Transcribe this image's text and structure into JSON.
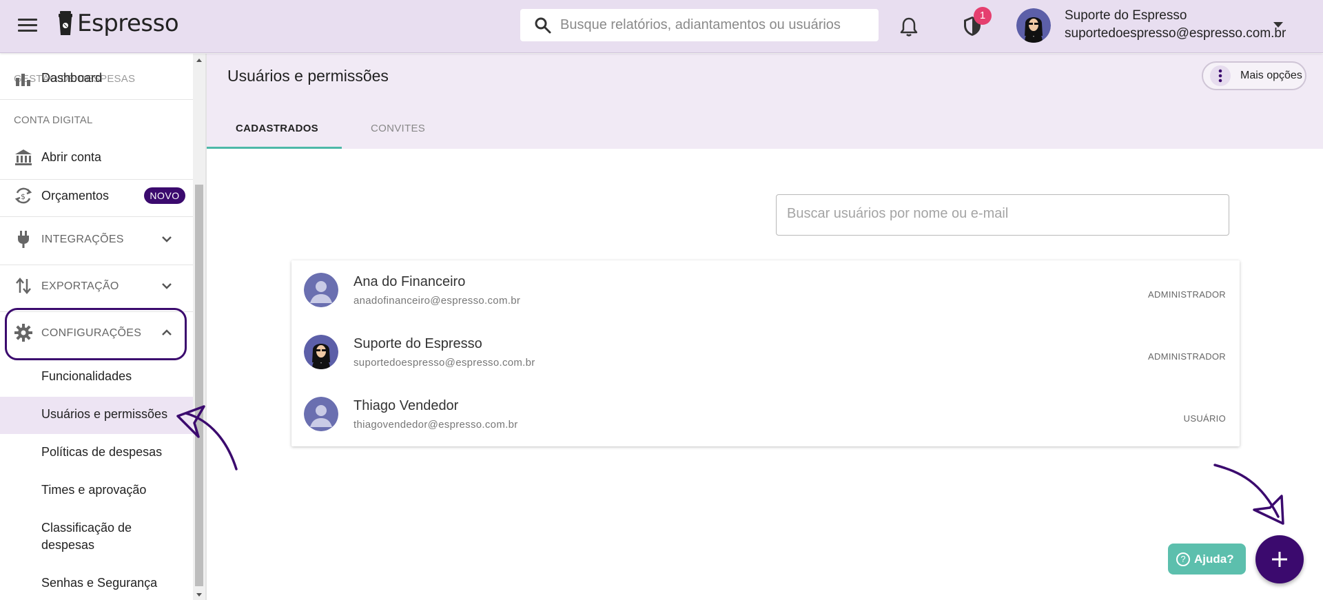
{
  "app": {
    "name": "Espresso"
  },
  "search": {
    "placeholder": "Busque relatórios, adiantamentos ou usuários"
  },
  "notifications": {
    "security_badge": "1"
  },
  "user": {
    "name": "Suporte do Espresso",
    "email": "suportedoespresso@espresso.com.br"
  },
  "sidebar": {
    "overlap_section": "GESTÃO DE DESPESAS",
    "dashboard": "Dashboard",
    "section_conta": "CONTA DIGITAL",
    "abrir_conta": "Abrir conta",
    "orcamentos": "Orçamentos",
    "novo_badge": "NOVO",
    "integracoes": "INTEGRAÇÕES",
    "exportacao": "EXPORTAÇÃO",
    "configuracoes": "CONFIGURAÇÕES",
    "sub_items": [
      "Funcionalidades",
      "Usuários e permissões",
      "Políticas de despesas",
      "Times e aprovação",
      "Classificação de",
      "despesas",
      "Senhas e Segurança"
    ]
  },
  "page": {
    "title": "Usuários e permissões",
    "more_options": "Mais opções",
    "tabs": [
      "CADASTRADOS",
      "CONVITES"
    ],
    "filter_placeholder": "Buscar usuários por nome ou e-mail"
  },
  "users": [
    {
      "name": "Ana do Financeiro",
      "email": "anadofinanceiro@espresso.com.br",
      "role": "ADMINISTRADOR"
    },
    {
      "name": "Suporte do Espresso",
      "email": "suportedoespresso@espresso.com.br",
      "role": "ADMINISTRADOR"
    },
    {
      "name": "Thiago Vendedor",
      "email": "thiagovendedor@espresso.com.br",
      "role": "USUÁRIO"
    }
  ],
  "help": {
    "label": "Ajuda?"
  },
  "colors": {
    "brand_purple": "#3b0a6e",
    "accent_teal": "#4db8a8",
    "header_bg": "#e8def0",
    "badge_red": "#e53f6f"
  }
}
